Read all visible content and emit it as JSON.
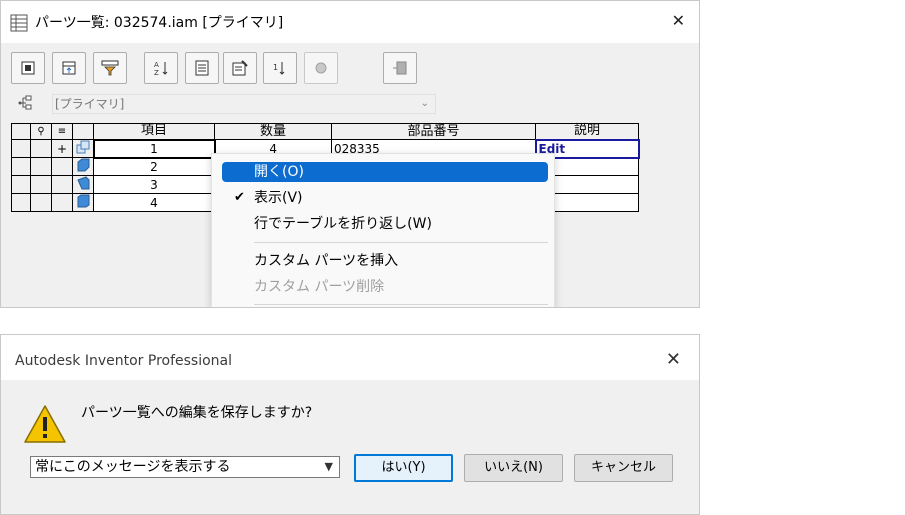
{
  "parts_window": {
    "title": "パーツ一覧: 032574.iam [プライマリ]",
    "close_glyph": "✕",
    "toolbar": {
      "buttons": [
        "filter",
        "export",
        "format",
        "sort",
        "table",
        "properties",
        "renumber",
        "merge",
        "compare"
      ]
    },
    "view_select": {
      "value": "[プライマリ]"
    },
    "table": {
      "headers": [
        "項目",
        "数量",
        "部品番号",
        "説明"
      ],
      "rows": [
        {
          "expand": "+",
          "item": "1",
          "qty": "4",
          "part": "028335",
          "desc": "Edit"
        },
        {
          "expand": "",
          "item": "2",
          "qty": "",
          "part": "",
          "desc": ""
        },
        {
          "expand": "",
          "item": "3",
          "qty": "",
          "part": "",
          "desc": ""
        },
        {
          "expand": "",
          "item": "4",
          "qty": "",
          "part": "",
          "desc": ""
        }
      ]
    },
    "context_menu": {
      "items": [
        {
          "label": "開く(O)",
          "selected": true,
          "disabled": false,
          "checked": false
        },
        {
          "label": "表示(V)",
          "selected": false,
          "disabled": false,
          "checked": true
        },
        {
          "label": "行でテーブルを折り返し(W)",
          "selected": false,
          "disabled": false,
          "checked": false
        },
        {
          "label": "カスタム パーツを挿入",
          "selected": false,
          "disabled": false,
          "checked": false
        },
        {
          "label": "カスタム パーツ削除",
          "selected": false,
          "disabled": true,
          "checked": false
        }
      ],
      "check_glyph": "✔"
    }
  },
  "dialog": {
    "title": "Autodesk Inventor Professional",
    "close_glyph": "✕",
    "message": "パーツ一覧への編集を保存しますか?",
    "dropdown_value": "常にこのメッセージを表示する",
    "buttons": {
      "yes": "はい(Y)",
      "no": "いいえ(N)",
      "cancel": "キャンセル"
    }
  },
  "colors": {
    "selection": "#0c6ccf",
    "edit_text": "#1b1b9b",
    "primary_button_border": "#0078d7",
    "warning_yellow": "#f5c400"
  }
}
